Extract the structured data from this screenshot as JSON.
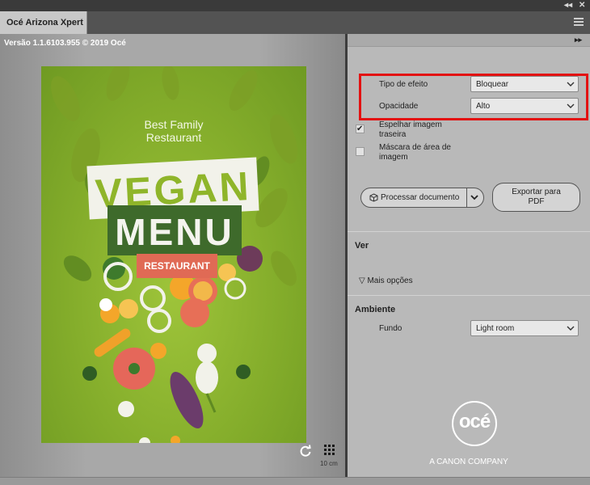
{
  "window": {
    "tab_title": "Océ Arizona Xpert",
    "collapse_icon": "double-left-arrow",
    "close_icon": "x",
    "menu_icon": "hamburger"
  },
  "preview": {
    "version_text": "Versão 1.1.6103.955 © 2019 Océ",
    "poster": {
      "subtitle_line1": "Best Family",
      "subtitle_line2": "Restaurant",
      "title_word1": "VEGAN",
      "title_word2": "MENU",
      "badge": "RESTAURANT",
      "colors": {
        "background": "#84ad2b",
        "vegan_text": "#8fb52a",
        "menu_bg": "#3e6a2b",
        "badge_bg": "#e06a55"
      }
    },
    "scale_label": "10 cm"
  },
  "panel": {
    "expand_icon": "double-right-arrow",
    "effect_type": {
      "label": "Tipo de efeito",
      "value": "Bloquear"
    },
    "opacity": {
      "label": "Opacidade",
      "value": "Alto"
    },
    "mirror_backside": {
      "label_line1": "Espelhar imagem",
      "label_line2": "traseira",
      "checked": true
    },
    "image_area_mask": {
      "label_line1": "Máscara de área de",
      "label_line2": "imagem",
      "checked": false
    },
    "process_button": "Processar documento",
    "export_button_line1": "Exportar para",
    "export_button_line2": "PDF",
    "view_section": "Ver",
    "more_options": "Mais opções",
    "environment_section": "Ambiente",
    "background": {
      "label": "Fundo",
      "value": "Light room"
    },
    "brand_logo": "océ",
    "brand_tagline": "A CANON COMPANY",
    "highlight_color": "#e31212"
  }
}
